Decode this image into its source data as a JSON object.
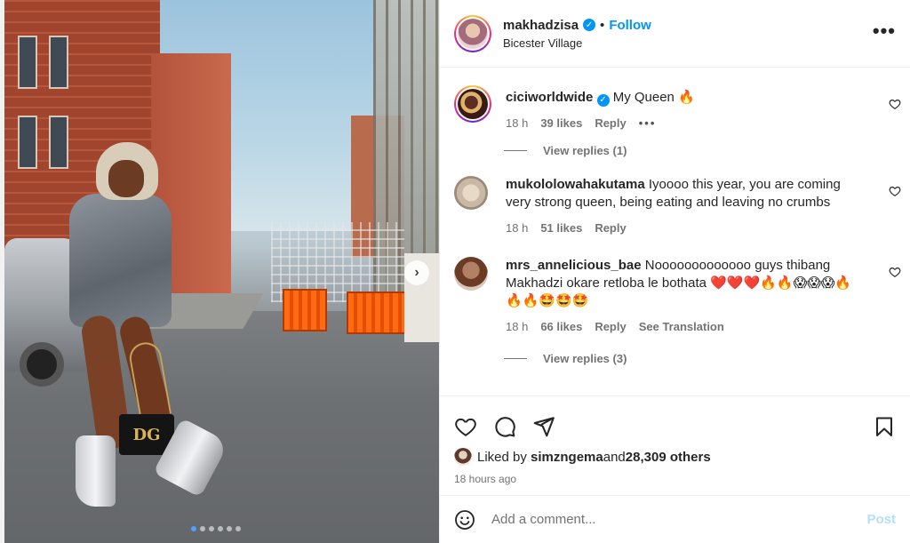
{
  "post": {
    "author": "makhadzisa",
    "separator": "•",
    "follow_label": "Follow",
    "location": "Bicester Village",
    "more_label": "•••",
    "photo": {
      "bag_text": "DG",
      "next_arrow": "›",
      "slide_count": 6,
      "active_slide": 1
    }
  },
  "comments": [
    {
      "user": "ciciworldwide",
      "verified": true,
      "text": " My Queen 🔥",
      "time": "18 h",
      "likes": "39 likes",
      "reply": "Reply",
      "more": "•••",
      "view_replies": "View replies (1)"
    },
    {
      "user": "mukololowahakutama",
      "text": " Iyoooo this year, you are coming very strong queen, being eating and leaving no crumbs",
      "time": "18 h",
      "likes": "51 likes",
      "reply": "Reply"
    },
    {
      "user": "mrs_annelicious_bae",
      "text": " Nooooooooooooo guys thibang Makhadzi okare retloba le bothata ❤️❤️❤️🔥🔥😱😱😱🔥🔥🔥🤩🤩🤩",
      "time": "18 h",
      "likes": "66 likes",
      "reply": "Reply",
      "translation": "See Translation",
      "view_replies": "View replies (3)"
    }
  ],
  "likes": {
    "prefix": "Liked by ",
    "user": "simzngema",
    "middle": " and ",
    "others": "28,309 others"
  },
  "time_ago": "18 hours ago",
  "composer": {
    "placeholder": "Add a comment...",
    "post_label": "Post"
  },
  "colors": {
    "accent": "#0095f6",
    "post_disabled": "#b2dffc",
    "muted": "#737373"
  }
}
